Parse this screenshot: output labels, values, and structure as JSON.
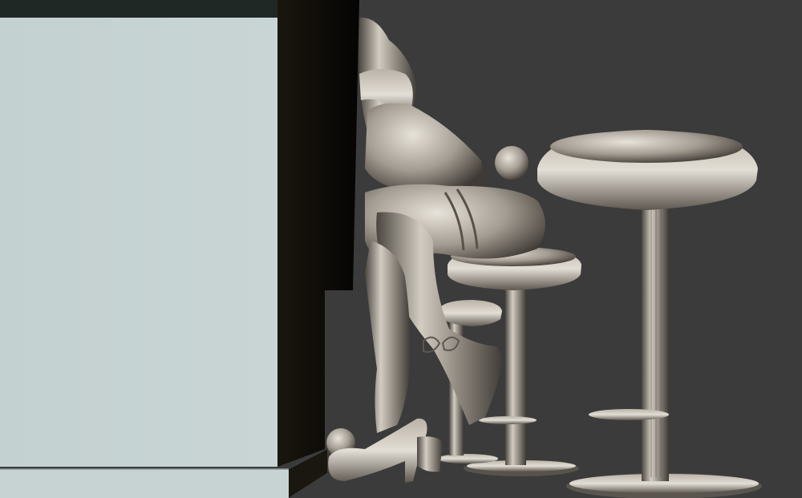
{
  "scene": {
    "background_color": "#3b3b3b",
    "material": "metallic-silver",
    "colors": {
      "counter_face": "#c6d3d3",
      "counter_shadow": "#0f0d09",
      "metal_light": "#d2ccc2",
      "metal_mid": "#9a938a",
      "metal_dark": "#4a453f"
    }
  }
}
